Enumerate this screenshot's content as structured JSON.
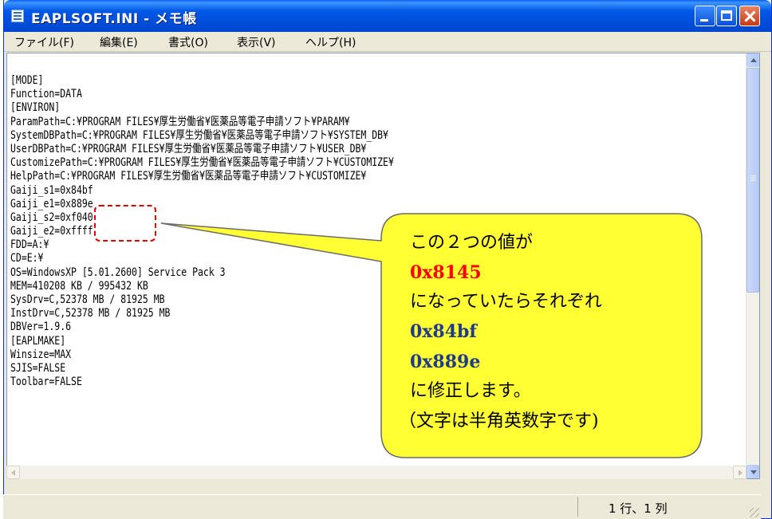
{
  "window": {
    "title": "EAPLSOFT.INI - メモ帳",
    "colors": {
      "titlebar": "#0058e6",
      "close_button": "#c53a12",
      "menu_bg": "#ece9d8"
    }
  },
  "menu": [
    "ファイル(F)",
    "編集(E)",
    "書式(O)",
    "表示(V)",
    "ヘルプ(H)"
  ],
  "document": {
    "lines": [
      "[MODE]",
      "Function=DATA",
      "[ENVIRON]",
      "ParamPath=C:¥PROGRAM FILES¥厚生労働省¥医薬品等電子申請ソフト¥PARAM¥",
      "SystemDBPath=C:¥PROGRAM FILES¥厚生労働省¥医薬品等電子申請ソフト¥SYSTEM_DB¥",
      "UserDBPath=C:¥PROGRAM FILES¥厚生労働省¥医薬品等電子申請ソフト¥USER_DB¥",
      "CustomizePath=C:¥PROGRAM FILES¥厚生労働省¥医薬品等電子申請ソフト¥CUSTOMIZE¥",
      "HelpPath=C:¥PROGRAM FILES¥厚生労働省¥医薬品等電子申請ソフト¥CUSTOMIZE¥",
      "Gaiji_s1=0x84bf",
      "Gaiji_e1=0x889e",
      "Gaiji_s2=0xf040",
      "Gaiji_e2=0xffff",
      "FDD=A:¥",
      "CD=E:¥",
      "OS=WindowsXP [5.01.2600] Service Pack 3",
      "MEM=410208 KB / 995432 KB",
      "SysDrv=C,52378 MB / 81925 MB",
      "InstDrv=C,52378 MB / 81925 MB",
      "DBVer=1.9.6",
      "[EAPLMAKE]",
      "Winsize=MAX",
      "SJIS=FALSE",
      "Toolbar=FALSE"
    ]
  },
  "callout": {
    "line1": "この２つの値が",
    "line2": "0x8145",
    "line3": "になっていたらそれぞれ",
    "line4": "0x84bf",
    "line5": "0x889e",
    "line6": "に修正します。",
    "line7": "（文字は半角英数字です)",
    "colors": {
      "fill": "#ffff33",
      "stroke": "#6b6b6b",
      "highlight": "#e00000",
      "red_text": "#ff0000",
      "blue_text": "#1f3b8a"
    }
  },
  "status": {
    "position": "1 行、1 列"
  }
}
